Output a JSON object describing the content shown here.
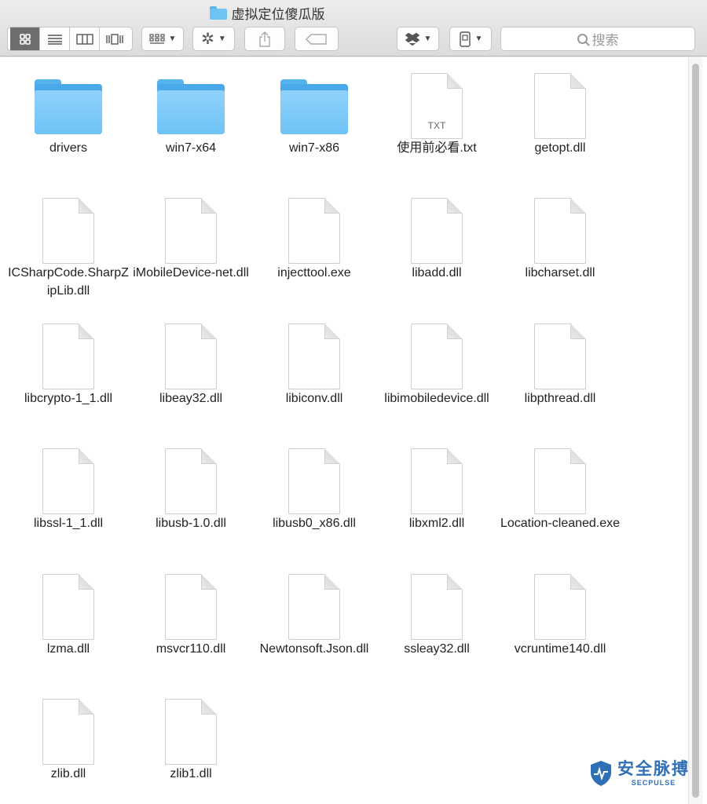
{
  "window": {
    "title": "虚拟定位傻瓜版",
    "title_icon": "folder-icon"
  },
  "toolbar": {
    "view_modes": [
      "icon-view",
      "list-view",
      "column-view",
      "cover-flow-view"
    ],
    "active_view": "icon-view",
    "arrange_icon": "arrange-grid-icon",
    "action_icon": "gear-icon",
    "share_icon": "share-icon",
    "tag_icon": "tag-icon",
    "dropbox_icon": "dropbox-icon",
    "device_icon": "device-icon",
    "search_placeholder": "搜索"
  },
  "files": [
    {
      "name": "drivers",
      "type": "folder"
    },
    {
      "name": "win7-x64",
      "type": "folder"
    },
    {
      "name": "win7-x86",
      "type": "folder"
    },
    {
      "name": "使用前必看.txt",
      "type": "txt",
      "badge": "TXT"
    },
    {
      "name": "getopt.dll",
      "type": "doc"
    },
    {
      "name": "ICSharpCode.SharpZipLib.dll",
      "type": "doc"
    },
    {
      "name": "iMobileDevice-net.dll",
      "type": "doc"
    },
    {
      "name": "injecttool.exe",
      "type": "doc"
    },
    {
      "name": "libadd.dll",
      "type": "doc"
    },
    {
      "name": "libcharset.dll",
      "type": "doc"
    },
    {
      "name": "libcrypto-1_1.dll",
      "type": "doc"
    },
    {
      "name": "libeay32.dll",
      "type": "doc"
    },
    {
      "name": "libiconv.dll",
      "type": "doc"
    },
    {
      "name": "libimobiledevice.dll",
      "type": "doc"
    },
    {
      "name": "libpthread.dll",
      "type": "doc"
    },
    {
      "name": "libssl-1_1.dll",
      "type": "doc"
    },
    {
      "name": "libusb-1.0.dll",
      "type": "doc"
    },
    {
      "name": "libusb0_x86.dll",
      "type": "doc"
    },
    {
      "name": "libxml2.dll",
      "type": "doc"
    },
    {
      "name": "Location-cleaned.exe",
      "type": "doc"
    },
    {
      "name": "lzma.dll",
      "type": "doc"
    },
    {
      "name": "msvcr110.dll",
      "type": "doc"
    },
    {
      "name": "Newtonsoft.Json.dll",
      "type": "doc"
    },
    {
      "name": "ssleay32.dll",
      "type": "doc"
    },
    {
      "name": "vcruntime140.dll",
      "type": "doc"
    },
    {
      "name": "zlib.dll",
      "type": "doc"
    },
    {
      "name": "zlib1.dll",
      "type": "doc"
    }
  ],
  "watermark": {
    "cn": "安全脉搏",
    "en": "SECPULSE"
  },
  "colors": {
    "folder": "#6ec3f6",
    "watermark": "#2f6fb5"
  }
}
